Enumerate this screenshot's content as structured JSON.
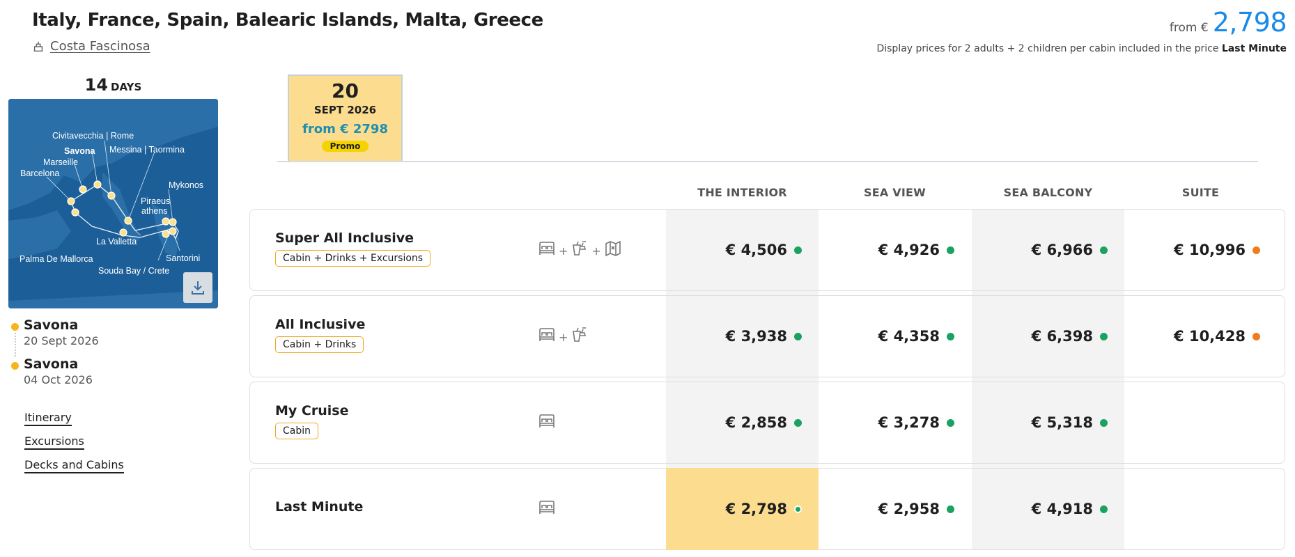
{
  "header": {
    "title": "Italy, France, Spain, Balearic Islands, Malta, Greece",
    "ship": "Costa Fascinosa",
    "from_label": "from €",
    "from_price": "2,798",
    "note_prefix": "Display prices for 2 adults + 2 children per cabin included in the price",
    "note_bold": "Last Minute"
  },
  "duration": {
    "number": "14",
    "unit": "DAYS"
  },
  "map": {
    "ports": [
      "Civitavecchia | Rome",
      "Savona",
      "Messina | Taormina",
      "Marseille",
      "Barcelona",
      "Mykonos",
      "Piraeus",
      "athens",
      "La Valletta",
      "Santorini",
      "Palma De Mallorca",
      "Souda Bay / Crete"
    ],
    "download_icon": "download-icon"
  },
  "route": [
    {
      "port": "Savona",
      "date": "20 Sept 2026"
    },
    {
      "port": "Savona",
      "date": "04 Oct 2026"
    }
  ],
  "links": [
    "Itinerary",
    "Excursions",
    "Decks and Cabins"
  ],
  "date_tab": {
    "day": "20",
    "month": "SEPT 2026",
    "from": "from € 2798",
    "promo": "Promo"
  },
  "columns": [
    "THE INTERIOR",
    "SEA VIEW",
    "SEA BALCONY",
    "SUITE"
  ],
  "plus": "+",
  "rows": [
    {
      "name": "Super All Inclusive",
      "badge": "Cabin + Drinks + Excursions",
      "icons": [
        "bed-icon",
        "drinks-icon",
        "map-icon"
      ],
      "prices": [
        "€ 4,506",
        "€ 4,926",
        "€ 6,966",
        "€ 10,996"
      ],
      "status": [
        "green",
        "green",
        "green",
        "orange"
      ]
    },
    {
      "name": "All Inclusive",
      "badge": "Cabin + Drinks",
      "icons": [
        "bed-icon",
        "drinks-icon"
      ],
      "prices": [
        "€ 3,938",
        "€ 4,358",
        "€ 6,398",
        "€ 10,428"
      ],
      "status": [
        "green",
        "green",
        "green",
        "orange"
      ]
    },
    {
      "name": "My Cruise",
      "badge": "Cabin",
      "icons": [
        "bed-icon"
      ],
      "prices": [
        "€ 2,858",
        "€ 3,278",
        "€ 5,318",
        ""
      ],
      "status": [
        "green",
        "green",
        "green",
        ""
      ]
    },
    {
      "name": "Last Minute",
      "badge": "",
      "icons": [
        "bed-icon"
      ],
      "prices": [
        "€ 2,798",
        "€ 2,958",
        "€ 4,918",
        ""
      ],
      "status": [
        "green",
        "green",
        "green",
        ""
      ]
    }
  ],
  "colors": {
    "accent_blue": "#1a8ae8",
    "highlight": "#fcdc8e",
    "available": "#1aa260",
    "limited": "#f07c1c",
    "badge_border": "#f0a820"
  }
}
